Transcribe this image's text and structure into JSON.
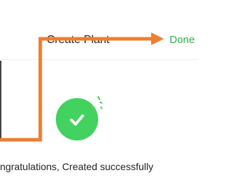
{
  "navbar": {
    "title": "Create Plant",
    "done_label": "Done"
  },
  "main": {
    "message": "ngratulations, Created successfully"
  },
  "colors": {
    "accent_green": "#2ab34a",
    "success_circle": "#43d15f",
    "annotation_orange": "#ef7d32"
  },
  "icons": {
    "success": "check-circle-icon",
    "annotation": "arrow-icon"
  }
}
